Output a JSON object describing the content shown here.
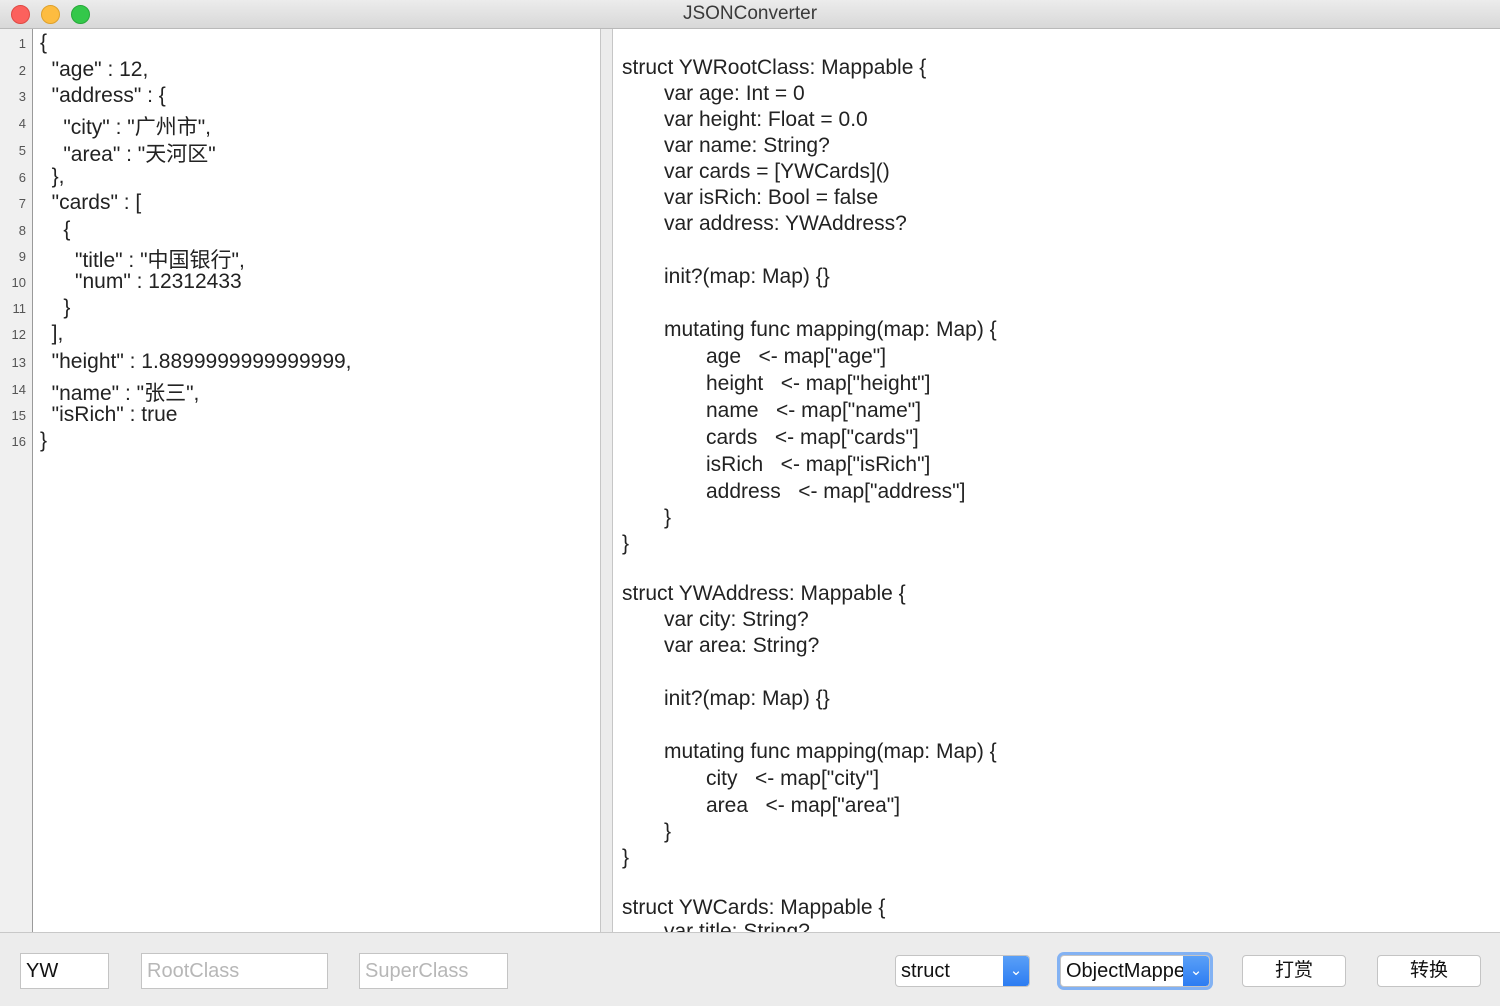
{
  "window": {
    "title": "JSONConverter"
  },
  "input": {
    "line_numbers": [
      "1",
      "2",
      "3",
      "4",
      "5",
      "6",
      "7",
      "8",
      "9",
      "10",
      "11",
      "12",
      "13",
      "14",
      "15",
      "16"
    ],
    "lines": [
      "{",
      "  \"age\" : 12,",
      "  \"address\" : {",
      "    \"city\" : \"广州市\",",
      "    \"area\" : \"天河区\"",
      "  },",
      "  \"cards\" : [",
      "    {",
      "      \"title\" : \"中国银行\",",
      "      \"num\" : 12312433",
      "    }",
      "  ],",
      "  \"height\" : 1.8899999999999999,",
      "  \"name\" : \"张三\",",
      "  \"isRich\" : true",
      "}"
    ]
  },
  "output": {
    "lines": [
      "struct YWRootClass: Mappable {",
      "var age: Int = 0",
      "var height: Float = 0.0",
      "var name: String?",
      "var cards = [YWCards]()",
      "var isRich: Bool = false",
      "var address: YWAddress?",
      "init?(map: Map) {}",
      "mutating func mapping(map: Map) {",
      "age   <- map[\"age\"]",
      "height   <- map[\"height\"]",
      "name   <- map[\"name\"]",
      "cards   <- map[\"cards\"]",
      "isRich   <- map[\"isRich\"]",
      "address   <- map[\"address\"]",
      "}",
      "}",
      "struct YWAddress: Mappable {",
      "var city: String?",
      "var area: String?",
      "init?(map: Map) {}",
      "mutating func mapping(map: Map) {",
      "city   <- map[\"city\"]",
      "area   <- map[\"area\"]",
      "}",
      "}",
      "struct YWCards: Mappable {",
      "var title: String?"
    ]
  },
  "bottom": {
    "prefix_value": "YW",
    "root_class_placeholder": "RootClass",
    "super_class_placeholder": "SuperClass",
    "struct_select": "struct",
    "framework_select": "ObjectMapper",
    "reward_button": "打赏",
    "convert_button": "转换"
  }
}
